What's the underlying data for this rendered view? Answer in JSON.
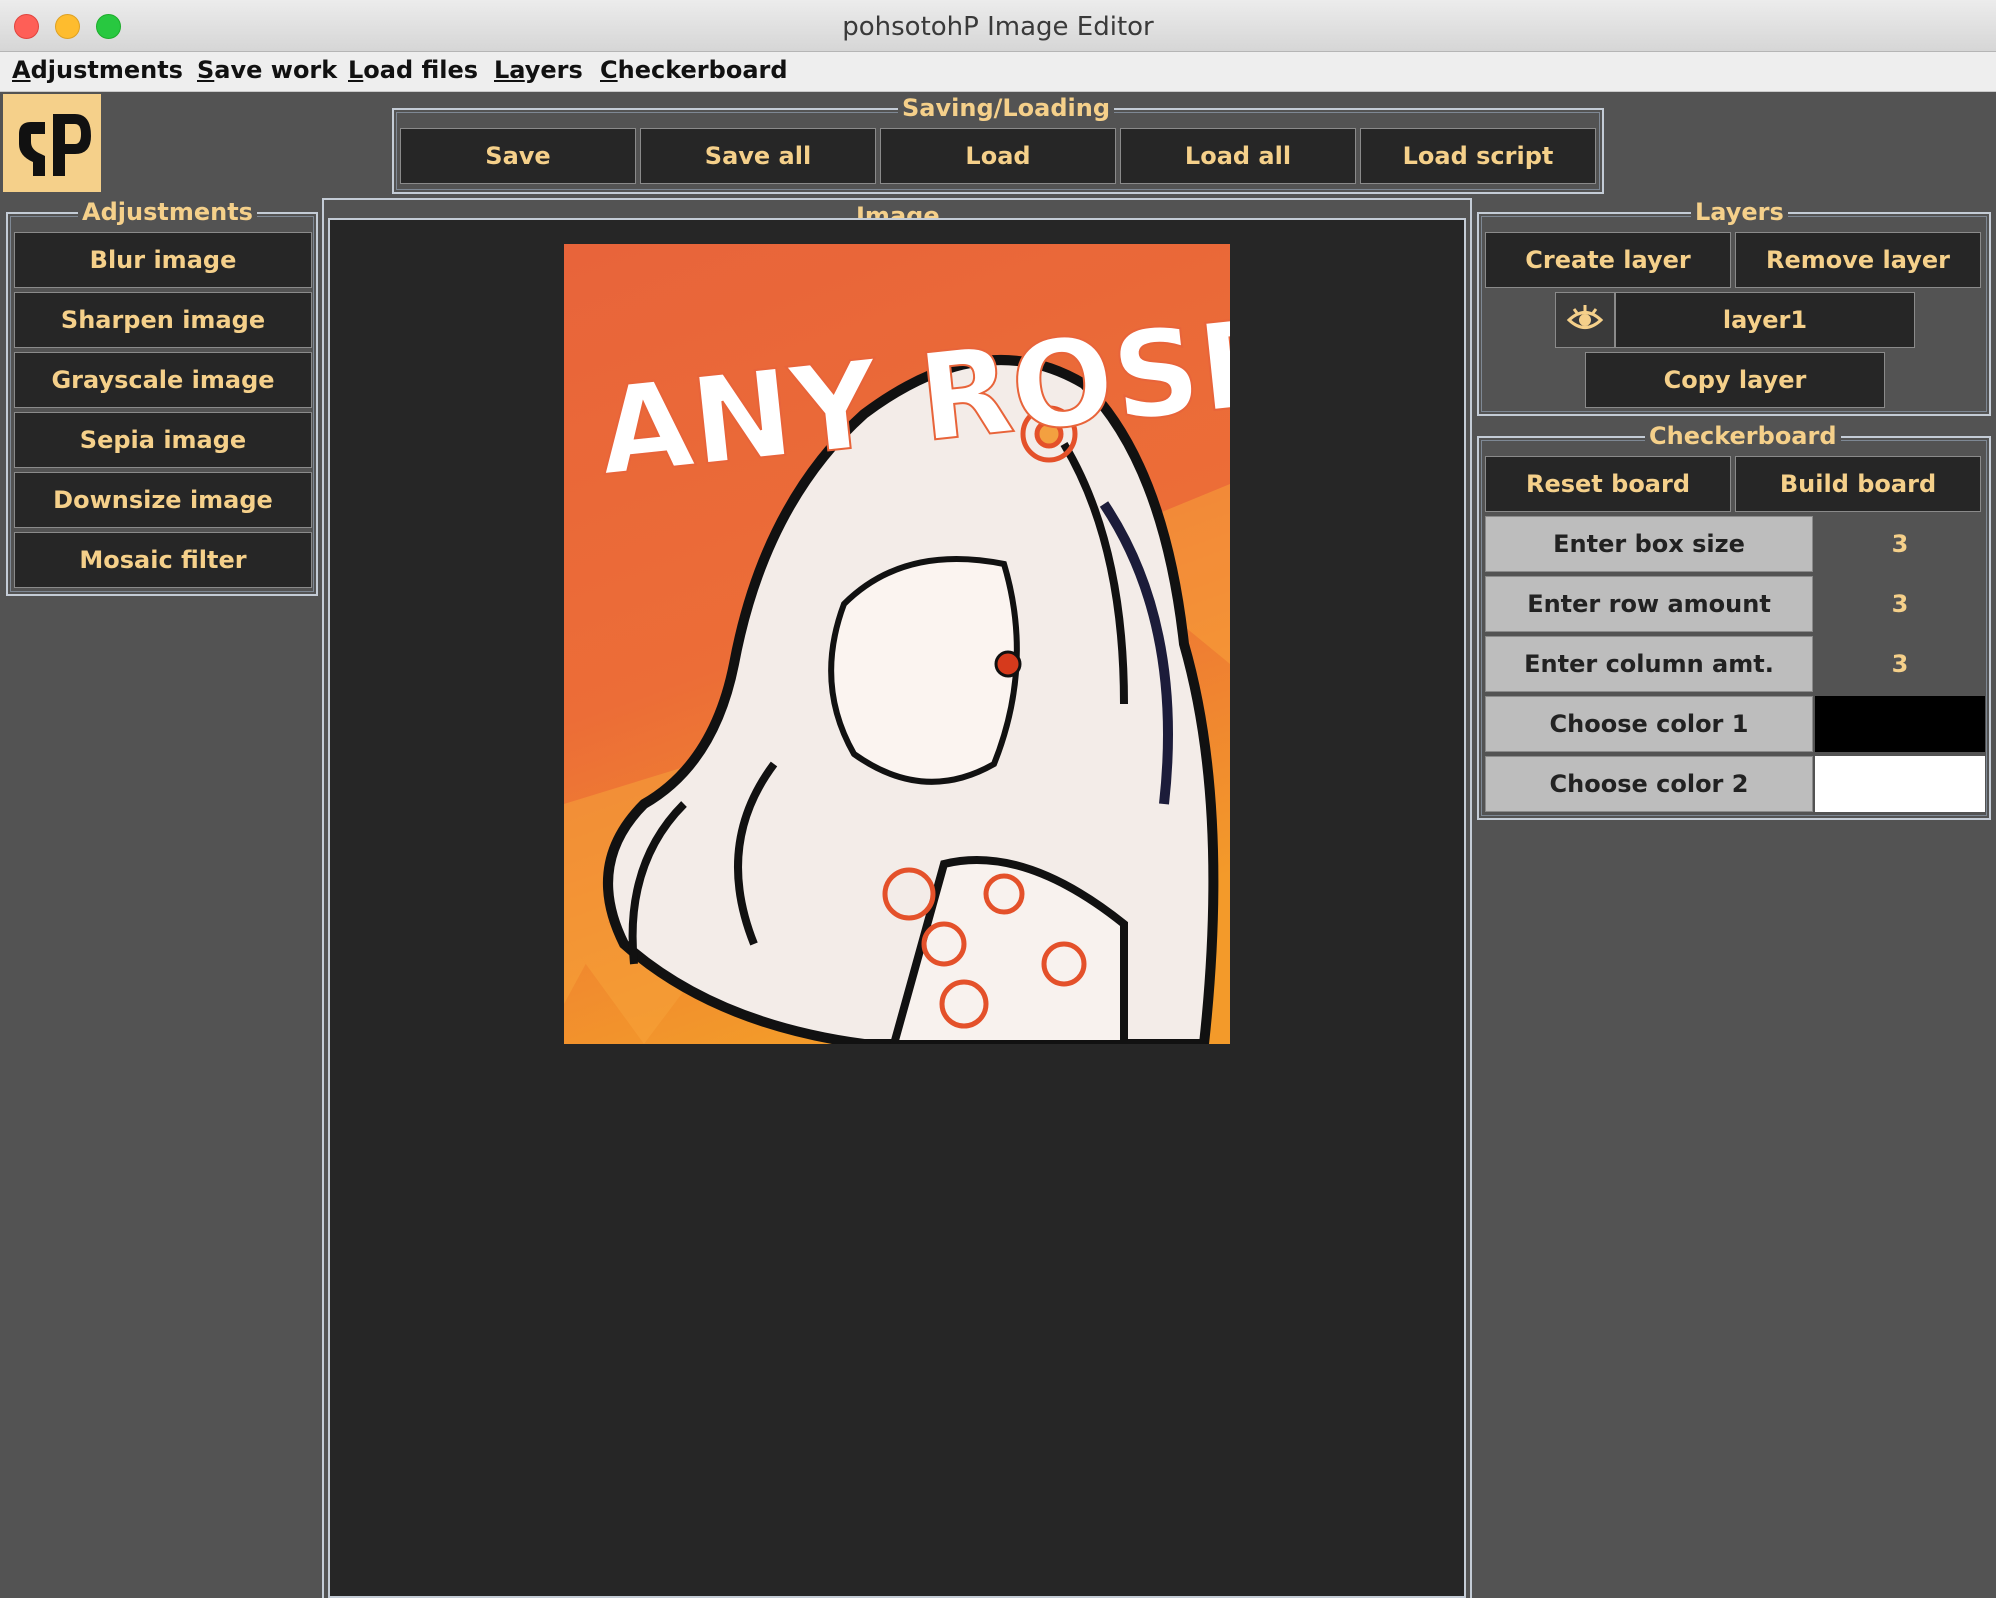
{
  "window": {
    "title": "pohsotohP Image Editor"
  },
  "menubar": {
    "items": [
      {
        "mnemonic": "A",
        "rest": "djustments"
      },
      {
        "mnemonic": "S",
        "rest": "ave work"
      },
      {
        "mnemonic": "L",
        "rest": "oad files"
      },
      {
        "mnemonic": "La",
        "rest": "yers"
      },
      {
        "mnemonic": "C",
        "rest": "heckerboard"
      }
    ]
  },
  "logo": {
    "text": "Ρʖ"
  },
  "saving": {
    "legend": "Saving/Loading",
    "buttons": [
      "Save",
      "Save all",
      "Load",
      "Load all",
      "Load script"
    ]
  },
  "adjustments": {
    "legend": "Adjustments",
    "buttons": [
      "Blur image",
      "Sharpen image",
      "Grayscale image",
      "Sepia image",
      "Downsize image",
      "Mosaic filter"
    ]
  },
  "image": {
    "legend": "Image",
    "poster_text": "ANY ROSE HAS THORNS"
  },
  "layers": {
    "legend": "Layers",
    "create": "Create layer",
    "remove": "Remove layer",
    "layer_name": "layer1",
    "copy": "Copy layer",
    "visibility_icon": "eye-icon"
  },
  "checkerboard": {
    "legend": "Checkerboard",
    "reset": "Reset board",
    "build": "Build board",
    "rows": [
      {
        "label": "Enter box size",
        "value": "3"
      },
      {
        "label": "Enter row amount",
        "value": "3"
      },
      {
        "label": "Enter column amt.",
        "value": "3"
      }
    ],
    "color1_label": "Choose color 1",
    "color2_label": "Choose color 2",
    "color1": "#000000",
    "color2": "#ffffff"
  },
  "colors": {
    "accent": "#f5d08a",
    "button_bg": "#262626",
    "panel_bg": "#535353",
    "poster_orange": "#e8643a"
  }
}
